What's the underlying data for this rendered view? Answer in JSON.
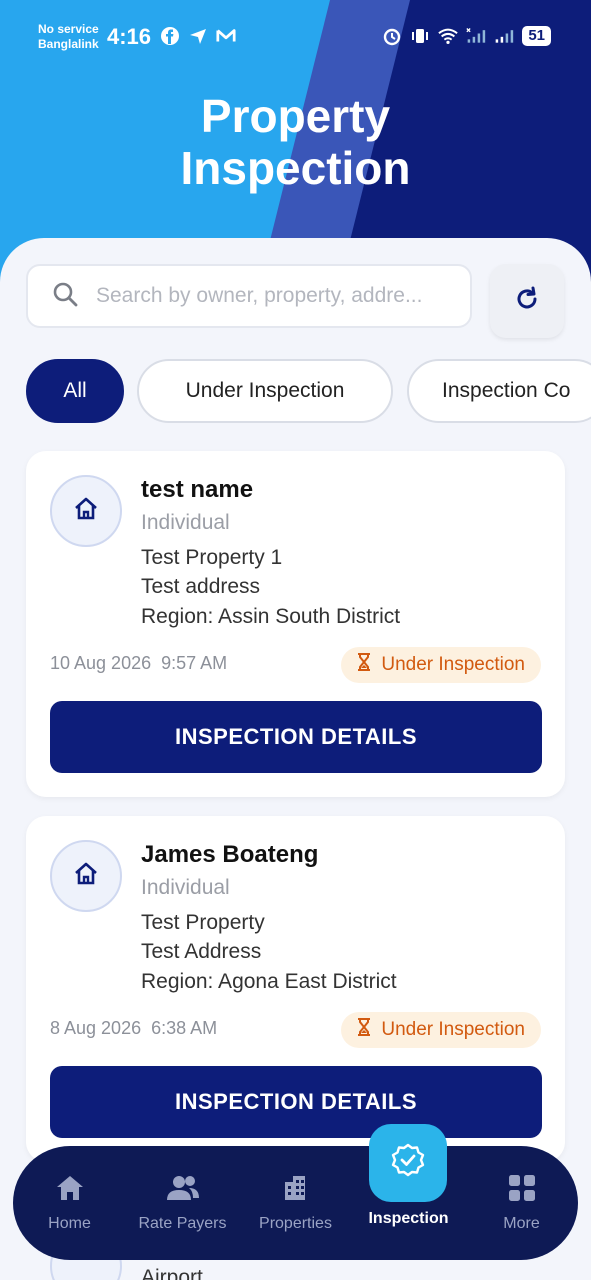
{
  "status_bar": {
    "carrier_line1": "No service",
    "carrier_line2": "Banglalink",
    "time": "4:16",
    "battery": "51"
  },
  "page_title_line1": "Property",
  "page_title_line2": "Inspection",
  "search": {
    "placeholder": "Search by owner, property, addre..."
  },
  "filters": [
    {
      "label": "All",
      "active": true
    },
    {
      "label": "Under Inspection",
      "active": false
    },
    {
      "label": "Inspection Co",
      "active": false
    }
  ],
  "cards": [
    {
      "name": "test name",
      "type": "Individual",
      "property": "Test Property 1",
      "address": "Test address",
      "region": "Region: Assin South District",
      "date": "10 Aug 2026",
      "time": "9:57 AM",
      "status": "Under Inspection",
      "button": "INSPECTION DETAILS"
    },
    {
      "name": "James Boateng",
      "type": "Individual",
      "property": "Test Property",
      "address": "Test Address",
      "region": "Region: Agona East District",
      "date": "8 Aug 2026",
      "time": "6:38 AM",
      "status": "Under Inspection",
      "button": "INSPECTION DETAILS"
    }
  ],
  "peek_card_text": "Airport",
  "nav": [
    {
      "label": "Home",
      "icon": "home-icon"
    },
    {
      "label": "Rate Payers",
      "icon": "users-icon"
    },
    {
      "label": "Properties",
      "icon": "building-icon"
    },
    {
      "label": "Inspection",
      "icon": "verified-badge-icon",
      "active": true
    },
    {
      "label": "More",
      "icon": "grid-icon"
    }
  ],
  "colors": {
    "primary": "#0d1d7a",
    "header_blue": "#28a6ee",
    "accent": "#2bb4ea",
    "status_orange": "#d25a10",
    "status_bg": "#fdf1e0",
    "nav_bg": "#0e1a55"
  }
}
